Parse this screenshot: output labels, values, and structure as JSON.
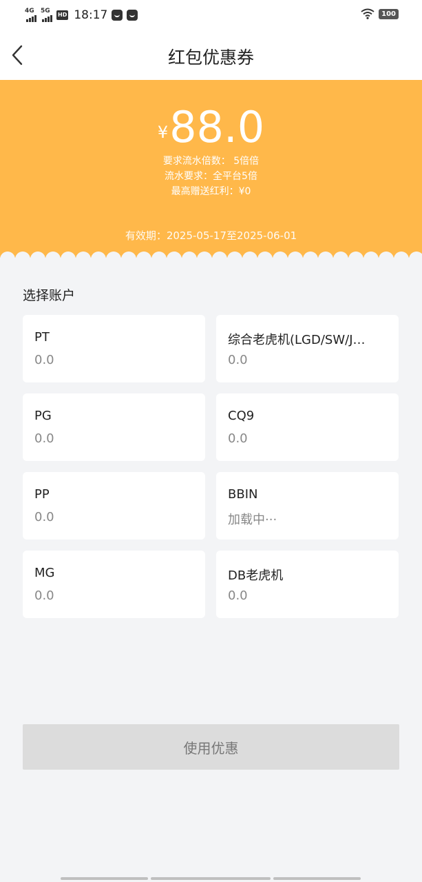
{
  "status_bar": {
    "net1": "4G",
    "net2": "5G",
    "hd": "HD",
    "time": "18:17",
    "battery": "100"
  },
  "header": {
    "title": "红包优惠券"
  },
  "coupon": {
    "currency": "¥",
    "amount": "88.0",
    "requirements": [
      "要求流水倍数： 5倍倍",
      "流水要求：全平台5倍",
      "最高赠送红利：¥0"
    ],
    "validity": "有效期：2025-05-17至2025-06-01",
    "color": "#ffb84a"
  },
  "accounts": {
    "title": "选择账户",
    "items": [
      {
        "name": "PT",
        "balance": "0.0"
      },
      {
        "name": "综合老虎机(LGD/SW/J…",
        "balance": "0.0"
      },
      {
        "name": "PG",
        "balance": "0.0"
      },
      {
        "name": "CQ9",
        "balance": "0.0"
      },
      {
        "name": "PP",
        "balance": "0.0"
      },
      {
        "name": "BBIN",
        "balance": "加载中···"
      },
      {
        "name": "MG",
        "balance": "0.0"
      },
      {
        "name": "DB老虎机",
        "balance": "0.0"
      }
    ]
  },
  "action": {
    "use_label": "使用优惠"
  }
}
